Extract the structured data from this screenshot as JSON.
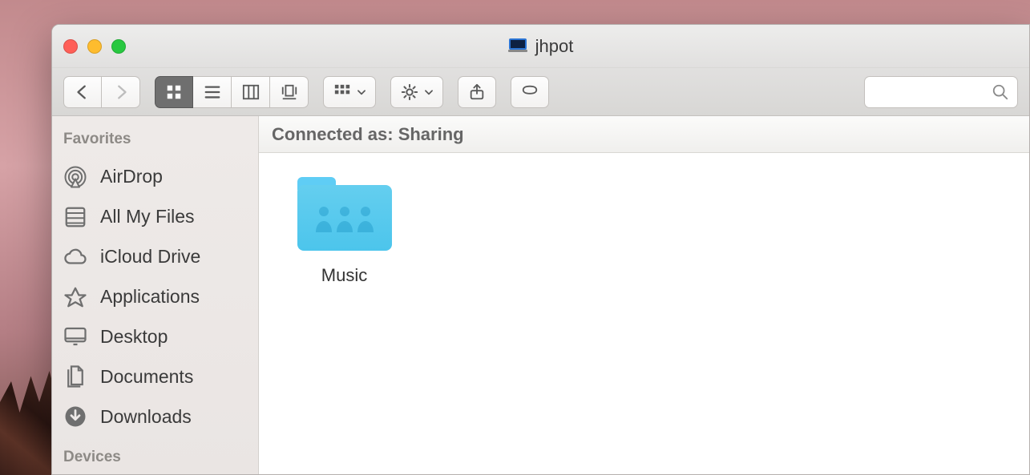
{
  "window": {
    "title": "jhpot"
  },
  "statusbar": {
    "text": "Connected as: Sharing"
  },
  "search": {
    "placeholder": ""
  },
  "sidebar": {
    "sections": [
      {
        "header": "Favorites",
        "items": [
          {
            "id": "airdrop",
            "label": "AirDrop",
            "icon": "airdrop-icon"
          },
          {
            "id": "all-my-files",
            "label": "All My Files",
            "icon": "all-my-files-icon"
          },
          {
            "id": "icloud",
            "label": "iCloud Drive",
            "icon": "icloud-icon"
          },
          {
            "id": "applications",
            "label": "Applications",
            "icon": "applications-icon"
          },
          {
            "id": "desktop",
            "label": "Desktop",
            "icon": "desktop-icon"
          },
          {
            "id": "documents",
            "label": "Documents",
            "icon": "documents-icon"
          },
          {
            "id": "downloads",
            "label": "Downloads",
            "icon": "downloads-icon"
          }
        ]
      },
      {
        "header": "Devices",
        "items": []
      }
    ]
  },
  "content": {
    "items": [
      {
        "label": "Music",
        "icon": "shared-folder-icon"
      }
    ]
  }
}
